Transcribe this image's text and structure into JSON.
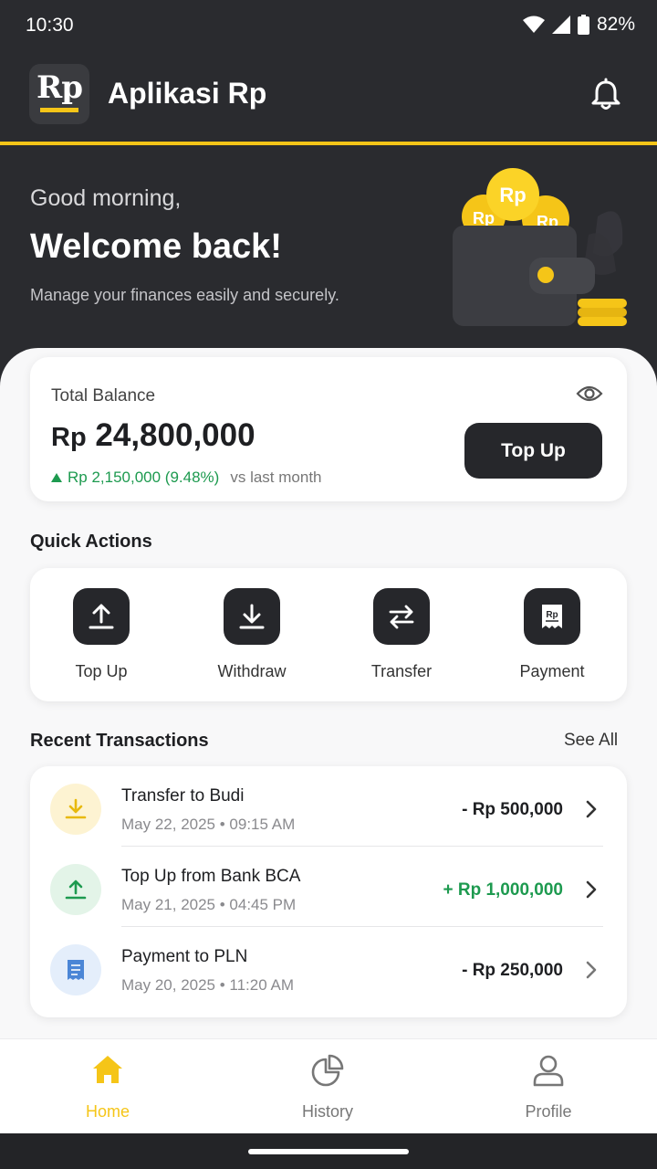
{
  "status_bar": {
    "time": "10:30",
    "battery": "82%"
  },
  "header": {
    "logo_text": "Rp",
    "title": "Aplikasi Rp",
    "bell_icon": "bell-icon"
  },
  "hero": {
    "greeting": "Good morning,",
    "welcome": "Welcome back!",
    "tagline": "Manage your finances easily and securely.",
    "coin_label": "Rp"
  },
  "balance": {
    "label": "Total Balance",
    "currency": "Rp",
    "amount": "24,800,000",
    "change": "Rp 2,150,000 (9.48%)",
    "change_suffix": "vs last month",
    "topup_label": "Top Up"
  },
  "quick_actions": {
    "title": "Quick Actions",
    "items": [
      {
        "label": "Top Up",
        "icon": "upload-icon"
      },
      {
        "label": "Withdraw",
        "icon": "download-icon"
      },
      {
        "label": "Transfer",
        "icon": "transfer-icon"
      },
      {
        "label": "Payment",
        "icon": "receipt-icon"
      }
    ]
  },
  "transactions": {
    "title": "Recent Transactions",
    "see_all": "See All",
    "items": [
      {
        "name": "Transfer to Budi",
        "date": "May 22, 2025 • 09:15 AM",
        "amount": "- Rp 500,000",
        "icon": "download-icon"
      },
      {
        "name": "Top Up from Bank BCA",
        "date": "May 21, 2025 • 04:45 PM",
        "amount": "+ Rp 1,000,000",
        "icon": "upload-icon"
      },
      {
        "name": "Payment to PLN",
        "date": "May 20, 2025 • 11:20 AM",
        "amount": "- Rp 250,000",
        "icon": "receipt-icon"
      }
    ]
  },
  "bottom_nav": {
    "items": [
      {
        "label": "Home",
        "icon": "home-icon",
        "active": true
      },
      {
        "label": "History",
        "icon": "pie-chart-icon",
        "active": false
      },
      {
        "label": "Profile",
        "icon": "user-icon",
        "active": false
      }
    ]
  },
  "colors": {
    "accent": "#f5c518",
    "dark": "#26272b",
    "positive": "#1d9a4f"
  }
}
